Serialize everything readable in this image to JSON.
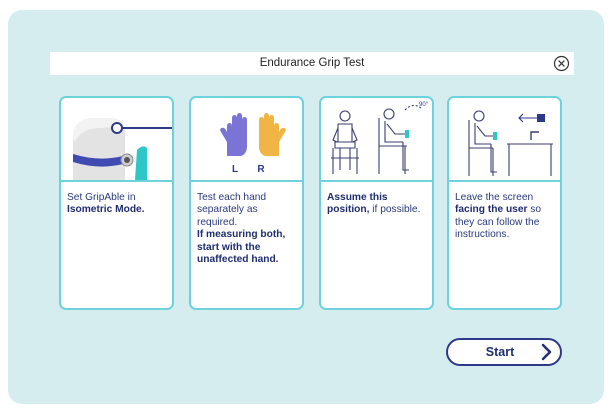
{
  "header": {
    "title": "Endurance Grip Test"
  },
  "cards": [
    {
      "pre": "Set GripAble in ",
      "bold": "Isometric Mode.",
      "post": ""
    },
    {
      "pre": "Test each hand separately as required.",
      "bold": "If measuring both, start with the unaffected hand.",
      "post": "",
      "labels": [
        "L",
        "R"
      ]
    },
    {
      "pre": "",
      "bold": "Assume this position,",
      "post": " if possible.",
      "angle": "90°"
    },
    {
      "pre": "Leave the screen ",
      "bold": "facing the user",
      "post": " so they can follow the instructions."
    }
  ],
  "start_button": {
    "label": "Start"
  },
  "colors": {
    "panel": "#d6edf0",
    "card_border": "#6dd2dc",
    "navy": "#1f2d6e",
    "left_hand": "#7b74d6",
    "right_hand": "#f0b545",
    "device_blue": "#3f4bb0",
    "device_teal": "#2ec7c7"
  }
}
